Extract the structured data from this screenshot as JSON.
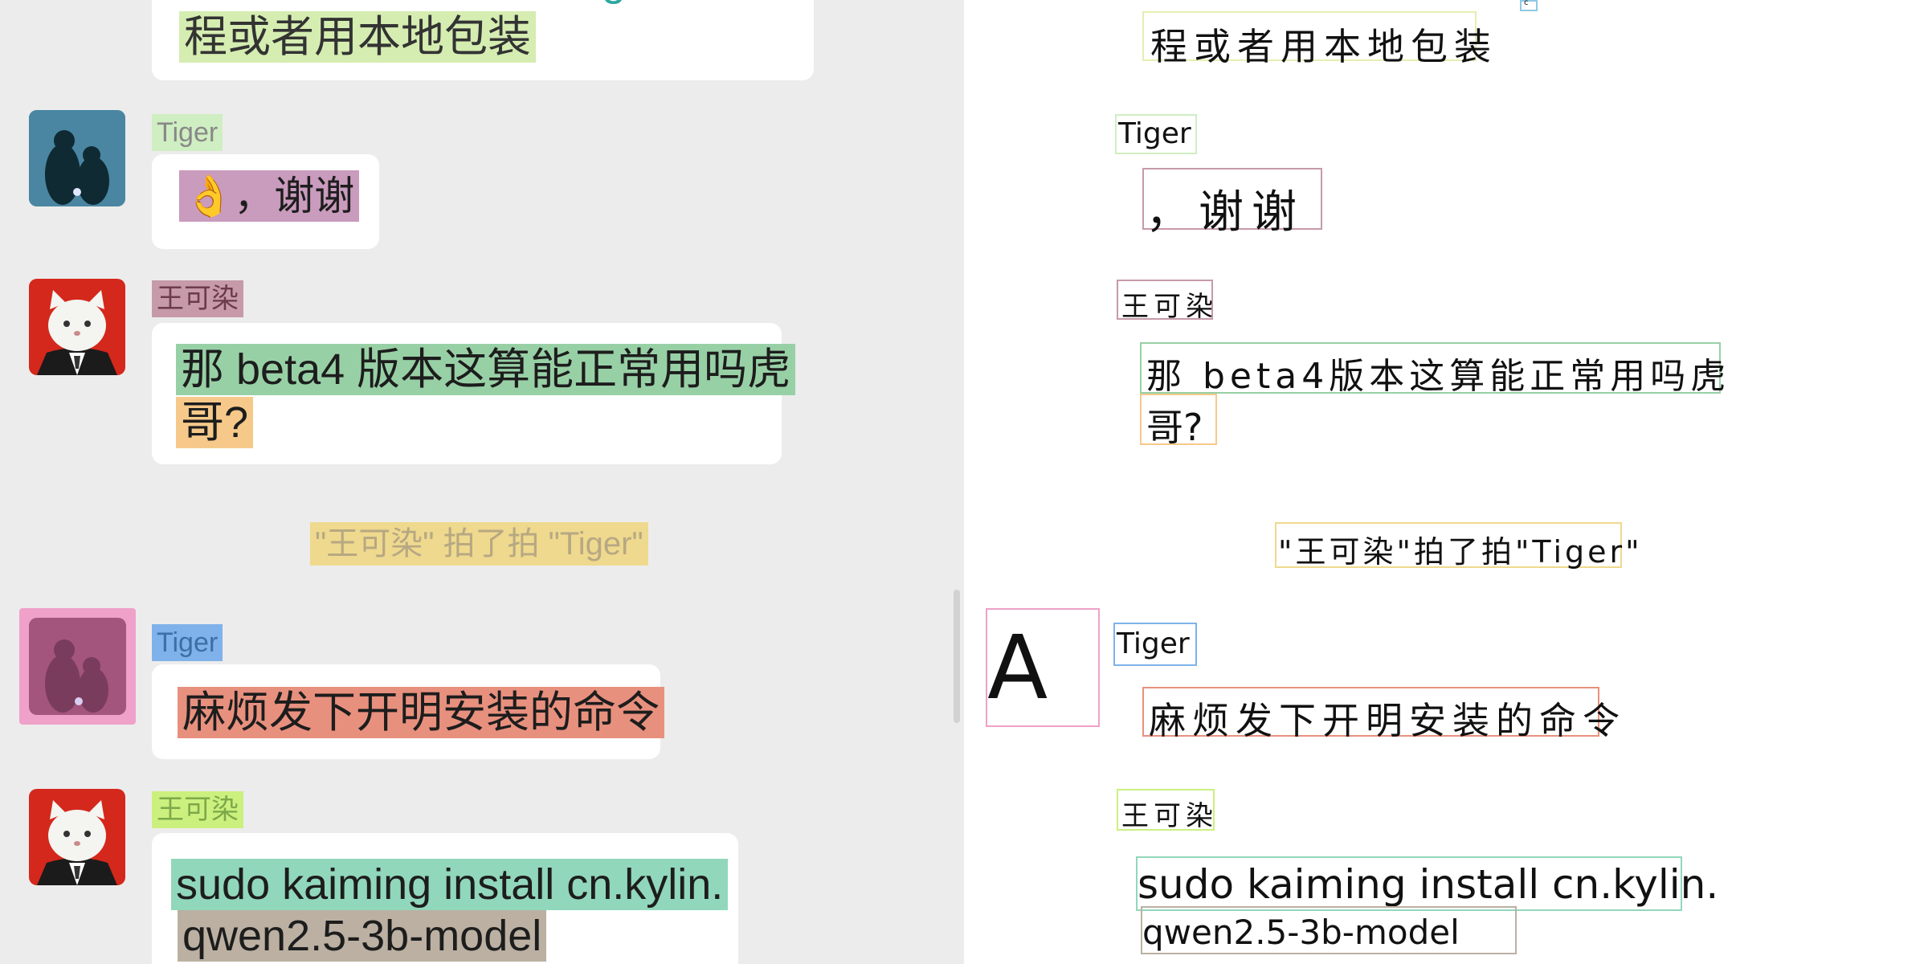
{
  "chat": {
    "top_message": {
      "line_clipped": "…g…",
      "line_last": "程或者用本地包装"
    },
    "messages": [
      {
        "sender": "Tiger",
        "text": "👌，谢谢"
      },
      {
        "sender": "王可染",
        "lines": [
          "那 beta4 版本这算能正常用吗虎",
          "哥?"
        ]
      },
      {
        "system": "\"王可染\" 拍了拍 \"Tiger\""
      },
      {
        "sender": "Tiger",
        "text": "麻烦发下开明安装的命令"
      },
      {
        "sender": "王可染",
        "lines": [
          "sudo kaiming install cn.kylin.",
          "qwen2.5-3b-model"
        ]
      }
    ]
  },
  "annotation": {
    "lines": [
      "程或者用本地包装",
      "Tiger",
      "，谢谢",
      "王可染",
      "那 beta4版本这算能正常用吗虎",
      "哥?",
      "\"王可染\"拍了拍\"Tiger\"",
      "A",
      "Tiger",
      "麻烦发下开明安装的命令",
      "王可染",
      "sudo kaiming install cn.kylin.",
      "qwen2.5-3b-model"
    ],
    "tiny_mark": "c"
  },
  "colors": {
    "chat_bg": "#ececec",
    "bubble_bg": "#ffffff",
    "highlight_green": "#8fd19e",
    "highlight_lime": "#c8ec9a",
    "highlight_pink": "#c78fb4",
    "highlight_orange": "#f7c47c",
    "highlight_yellow": "#f1d98a",
    "highlight_blue": "#7fb2ea",
    "highlight_red": "#e88a78",
    "highlight_teal": "#8fd8b8",
    "highlight_gray": "#b9aea0"
  }
}
